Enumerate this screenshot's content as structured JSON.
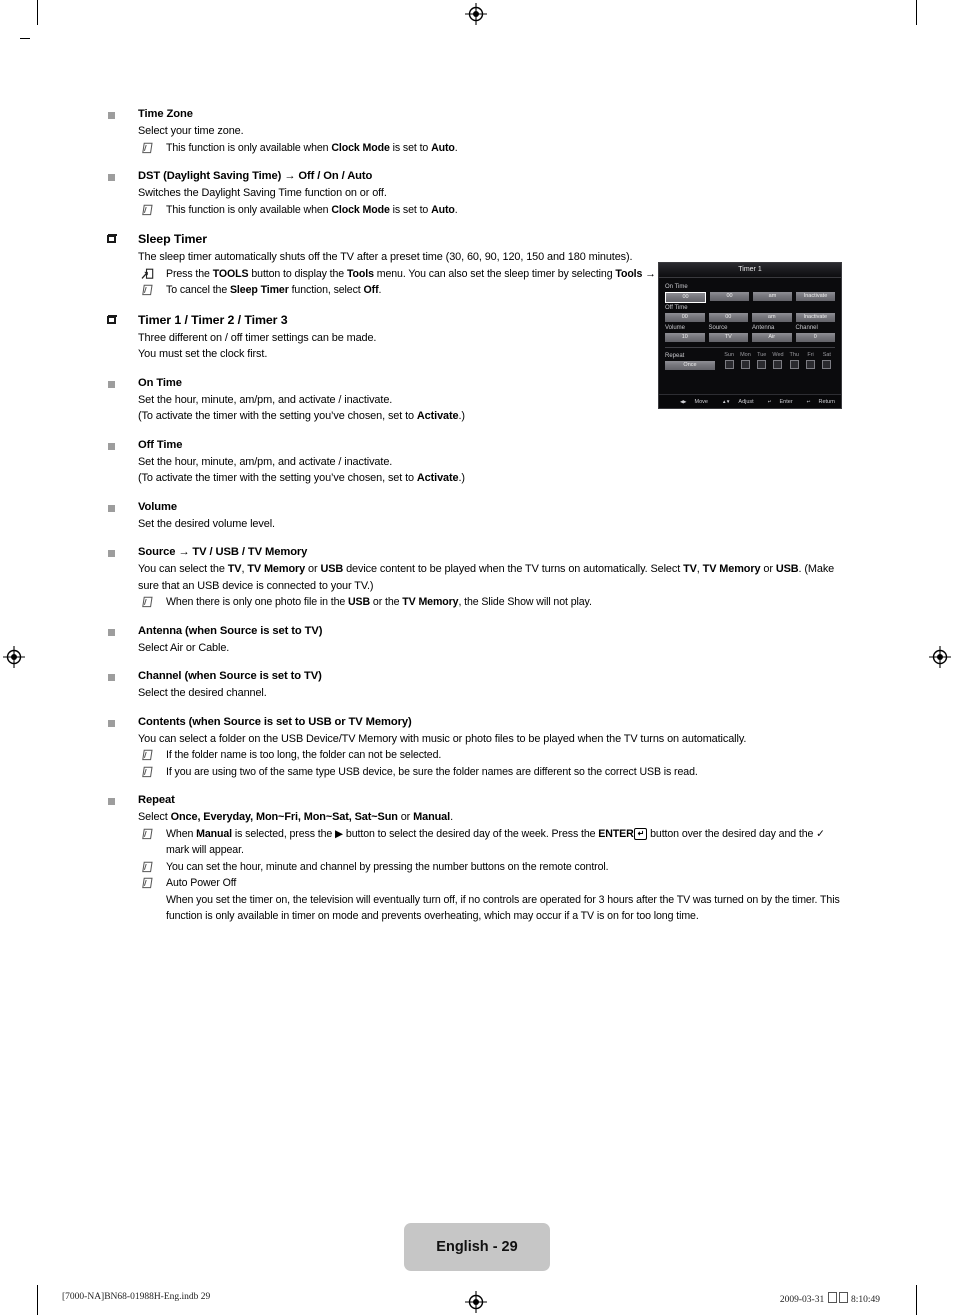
{
  "document": {
    "page_badge": "English - 29",
    "footer_left": "[7000-NA]BN68-01988H-Eng.indb   29",
    "footer_right_date": "2009-03-31",
    "footer_right_time": "8:10:49"
  },
  "sections": [
    {
      "id": "time-zone",
      "bullet": "square",
      "heading": "Time Zone",
      "lines": [
        "Select your time zone."
      ],
      "notes": [
        {
          "icon": "note-icon",
          "html": "This function is only available when <b>Clock Mode</b> is set to <b>Auto</b>."
        }
      ]
    },
    {
      "id": "dst",
      "bullet": "square",
      "heading_html": "DST (Daylight Saving Time) → Off / On / Auto",
      "lines": [
        "Switches the Daylight Saving Time function on or off."
      ],
      "notes": [
        {
          "icon": "note-icon",
          "html": "This function is only available when <b>Clock Mode</b> is set to <b>Auto</b>."
        }
      ]
    },
    {
      "id": "sleep-timer",
      "bullet": "open-square",
      "heading": "Sleep Timer",
      "lines": [
        "The sleep timer automatically shuts off the TV after a preset time (30, 60, 90, 120, 150 and 180 minutes)."
      ],
      "notes": [
        {
          "icon": "tools-icon",
          "html": "Press the <b>TOOLS</b> button to display the <b>Tools</b> menu. You can also set the sleep timer by selecting <b>Tools → Sleep Timer</b>."
        },
        {
          "icon": "note-icon",
          "html": "To cancel the <b>Sleep Timer</b> function, select <b>Off</b>."
        }
      ]
    },
    {
      "id": "timer-1-2-3",
      "bullet": "open-square",
      "heading": "Timer 1 / Timer 2 / Timer 3",
      "lines": [
        "Three different on / off timer settings can be made.",
        "You must set the clock first."
      ],
      "notes": []
    },
    {
      "id": "on-time",
      "bullet": "square",
      "heading": "On Time",
      "lines_html": [
        "Set the hour, minute, am/pm, and activate / inactivate.",
        "(To activate the timer with the setting you’ve chosen, set to <b>Activate</b>.)"
      ],
      "notes": []
    },
    {
      "id": "off-time",
      "bullet": "square",
      "heading": "Off Time",
      "lines_html": [
        "Set the hour, minute, am/pm, and activate / inactivate.",
        "(To activate the timer with the setting you’ve chosen, set to <b>Activate</b>.)"
      ],
      "notes": []
    },
    {
      "id": "volume",
      "bullet": "square",
      "heading": "Volume",
      "lines": [
        "Set the desired volume level."
      ],
      "notes": []
    },
    {
      "id": "source",
      "bullet": "square",
      "heading_html": "Source → TV / USB / TV Memory",
      "lines_html": [
        "You can select the <b>TV</b>, <b>TV Memory</b> or <b>USB</b> device content to be played when the TV turns on automatically. Select <b>TV</b>, <b>TV Memory</b> or <b>USB</b>. (Make sure that an USB device is connected to your TV.)"
      ],
      "notes": [
        {
          "icon": "note-icon",
          "html": "When there is only one photo file in the <b>USB</b> or the <b>TV Memory</b>, the Slide Show will not play."
        }
      ]
    },
    {
      "id": "antenna",
      "bullet": "square",
      "heading": "Antenna (when Source is set to TV)",
      "lines": [
        "Select Air or Cable."
      ],
      "notes": []
    },
    {
      "id": "channel",
      "bullet": "square",
      "heading": "Channel (when Source is set to TV)",
      "lines": [
        "Select the desired channel."
      ],
      "notes": []
    },
    {
      "id": "contents",
      "bullet": "square",
      "heading": "Contents (when Source is set to USB or TV Memory)",
      "lines": [
        "You can select a folder on the USB Device/TV Memory with music or photo files to be played when the TV turns on automatically."
      ],
      "notes": [
        {
          "icon": "note-icon",
          "html": "If the folder name is too long, the folder can not be selected."
        },
        {
          "icon": "note-icon",
          "html": "If you are using two of the same type USB device, be sure the folder names are different so the correct USB is read."
        }
      ]
    },
    {
      "id": "repeat",
      "bullet": "square",
      "heading": "Repeat",
      "lines_html": [
        "Select <b>Once, Everyday, Mon~Fri, Mon~Sat, Sat~Sun</b> or <b>Manual</b>."
      ],
      "notes": [
        {
          "icon": "note-icon",
          "html": "When <b>Manual</b> is selected, press the ▶ button to select the desired day of the week. Press the <b>ENTER</b><span class=\"enter-key\">↵</span> button over the desired day and the ✓ mark will appear."
        },
        {
          "icon": "note-icon",
          "html": "You can set the hour, minute and channel by pressing the number buttons on the remote control."
        },
        {
          "icon": "note-icon",
          "html": "Auto Power Off<br>When you set the timer on, the television will eventually turn off, if no controls are operated for 3 hours after the TV was turned on by the timer. This function is only available in timer on mode and prevents overheating, which may occur if a TV is on for too long time."
        }
      ]
    }
  ],
  "osd": {
    "title": "Timer 1",
    "on_time_label": "On Time",
    "on_time_values": [
      "00",
      "00",
      "am",
      "Inactivate"
    ],
    "off_time_label": "Off Time",
    "off_time_values": [
      "00",
      "00",
      "am",
      "Inactivate"
    ],
    "quad_labels": [
      "Volume",
      "Source",
      "Antenna",
      "Channel"
    ],
    "quad_values": [
      "10",
      "TV",
      "Air",
      "0"
    ],
    "repeat_label": "Repeat",
    "repeat_value": "Once",
    "days": [
      "Sun",
      "Mon",
      "Tue",
      "Wed",
      "Thu",
      "Fri",
      "Sat"
    ],
    "footer": [
      {
        "icon": "left-right-arrows-icon",
        "label": "Move"
      },
      {
        "icon": "up-down-arrows-icon",
        "label": "Adjust"
      },
      {
        "icon": "enter-key-icon",
        "label": "Enter"
      },
      {
        "icon": "return-arrow-icon",
        "label": "Return"
      }
    ]
  },
  "colors": {
    "badge_bg": "#c6c6c6",
    "bullet_grey": "#9d9d9d",
    "osd_bg": "#0b0b0d",
    "osd_cell": "#75757b"
  }
}
